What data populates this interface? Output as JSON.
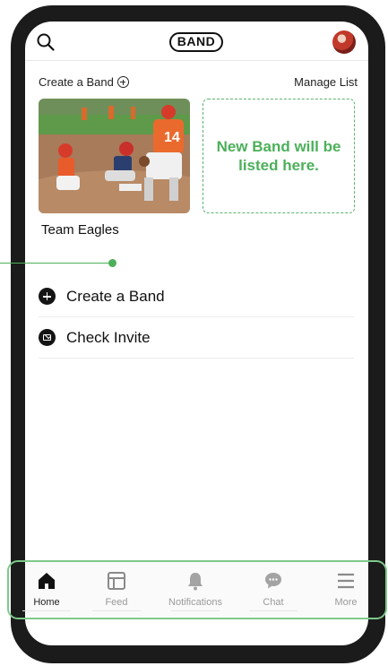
{
  "header": {
    "logo_text": "BAND",
    "search_icon": "search-icon",
    "avatar": "profile-avatar"
  },
  "create_row": {
    "create_label": "Create a Band",
    "manage_label": "Manage List"
  },
  "bands": [
    {
      "name": "Team Eagles"
    }
  ],
  "placeholder": {
    "text": "New Band will be listed here."
  },
  "menu": [
    {
      "label": "Create a Band",
      "icon": "plus-circle-icon"
    },
    {
      "label": "Check Invite",
      "icon": "mail-icon"
    }
  ],
  "tabs": [
    {
      "label": "Home",
      "icon": "home-icon",
      "active": true
    },
    {
      "label": "Feed",
      "icon": "feed-icon",
      "active": false
    },
    {
      "label": "Notifications",
      "icon": "bell-icon",
      "active": false
    },
    {
      "label": "Chat",
      "icon": "chat-bubble-icon",
      "active": false
    },
    {
      "label": "More",
      "icon": "hamburger-menu-icon",
      "active": false
    }
  ],
  "colors": {
    "accent_green": "#4cb05a",
    "frame_dark": "#1b1b1b"
  }
}
